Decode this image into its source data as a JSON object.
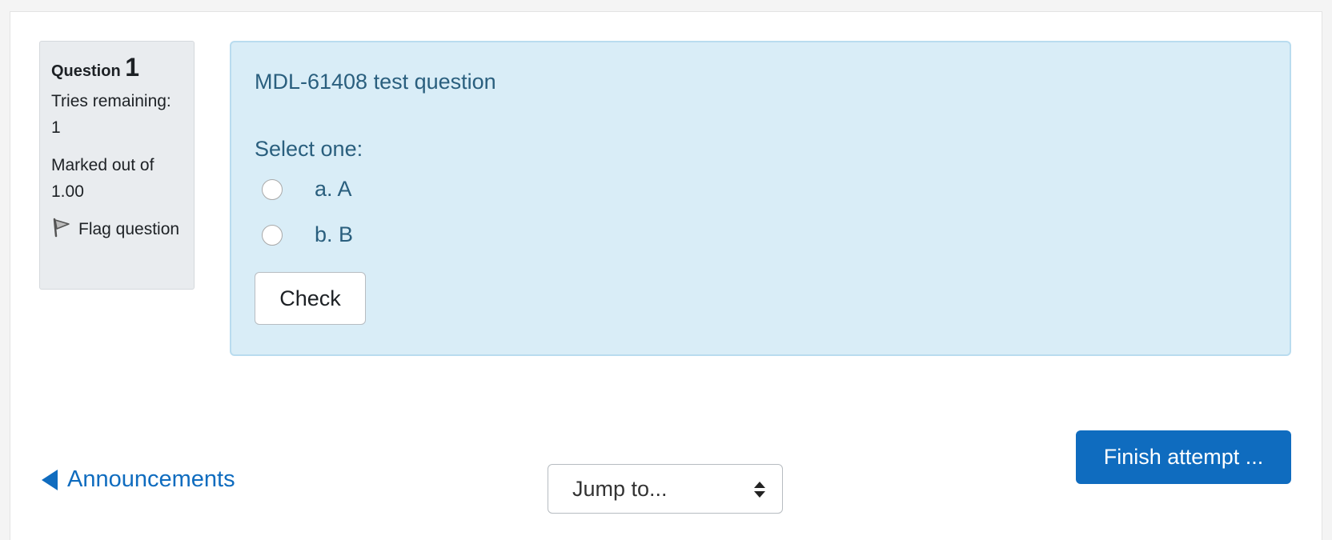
{
  "info": {
    "question_word": "Question",
    "question_number": "1",
    "tries_label": "Tries remaining:",
    "tries_value": "1",
    "marked_label": "Marked out of",
    "marked_value": "1.00",
    "flag_label": "Flag question"
  },
  "question": {
    "title": "MDL-61408 test question",
    "prompt": "Select one:",
    "options": [
      {
        "label": "a. A"
      },
      {
        "label": "b. B"
      }
    ],
    "check_label": "Check"
  },
  "footer": {
    "finish_label": "Finish attempt ...",
    "prev_link_label": "Announcements",
    "jump_label": "Jump to..."
  },
  "colors": {
    "accent": "#0f6cbf",
    "content_bg": "#d9edf7",
    "info_bg": "#e9ecef"
  },
  "icons": {
    "flag": "flag-icon",
    "prev": "caret-left-icon",
    "select": "sort-arrows-icon"
  }
}
